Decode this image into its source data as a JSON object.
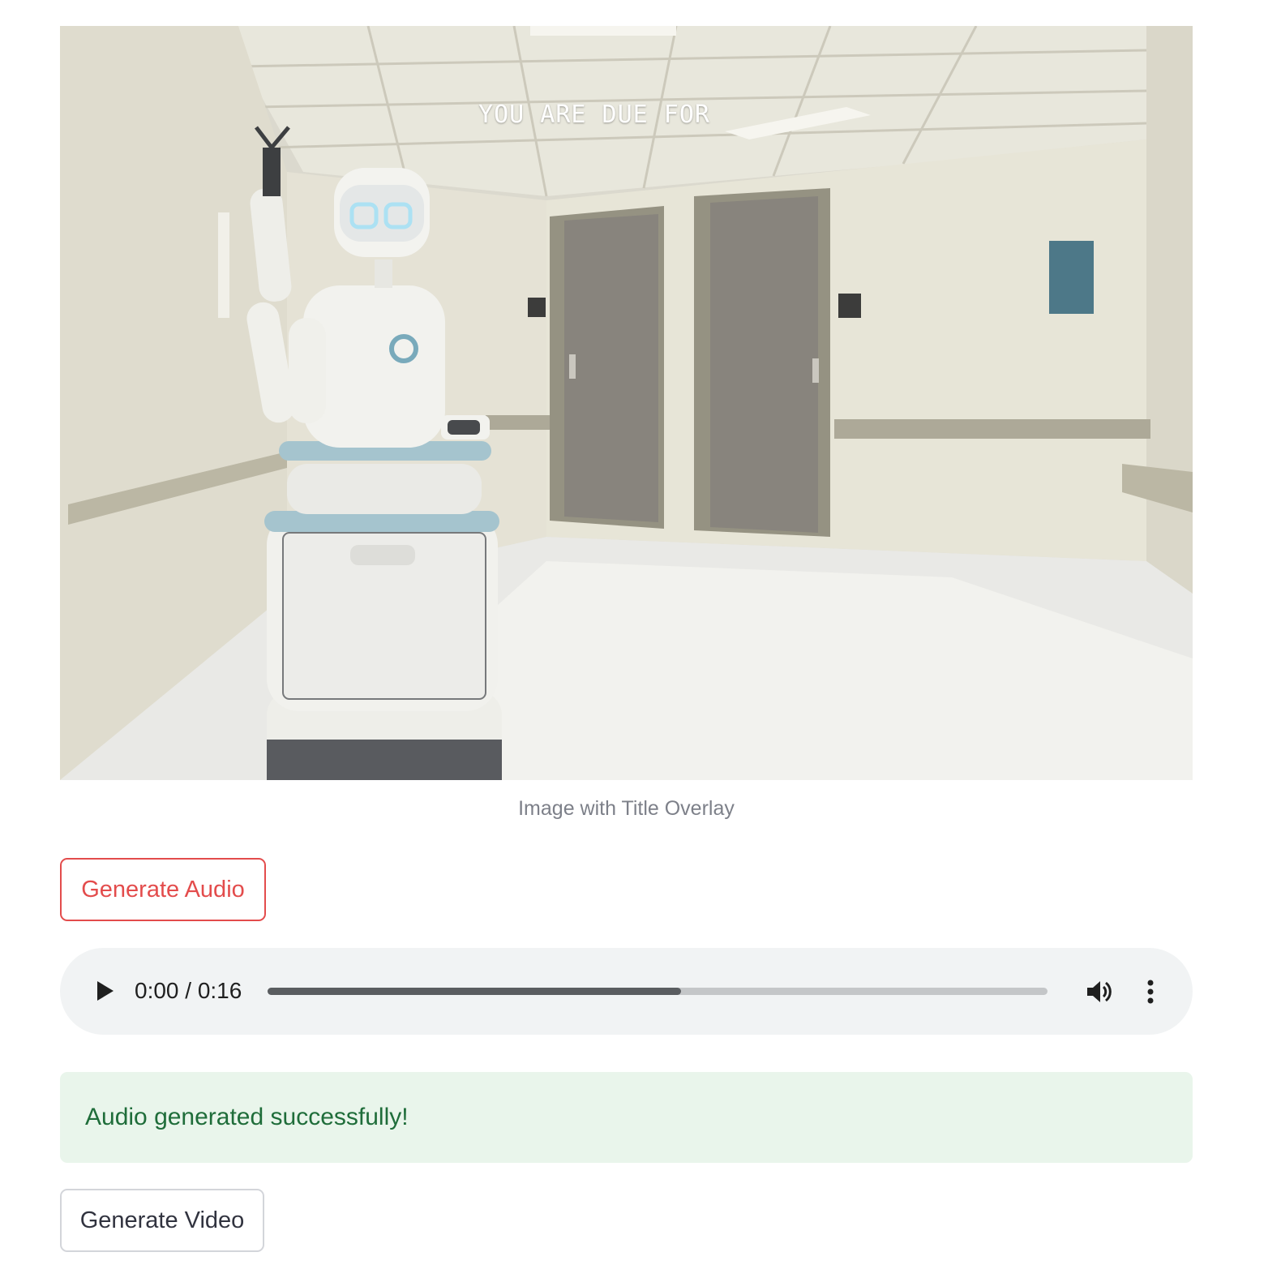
{
  "image": {
    "overlay_title": "YOU ARE DUE FOR",
    "caption": "Image with Title Overlay"
  },
  "buttons": {
    "generate_audio": "Generate Audio",
    "generate_video": "Generate Video"
  },
  "audio_player": {
    "time_display": "0:00 / 0:16",
    "progress_fraction": 0.53,
    "icons": [
      "play-icon",
      "volume-icon",
      "more-vert-icon"
    ]
  },
  "status": {
    "success_message": "Audio generated successfully!"
  },
  "colors": {
    "accent": "#e34c4c",
    "success_bg": "#e9f5eb",
    "success_text": "#1f6d3a"
  }
}
